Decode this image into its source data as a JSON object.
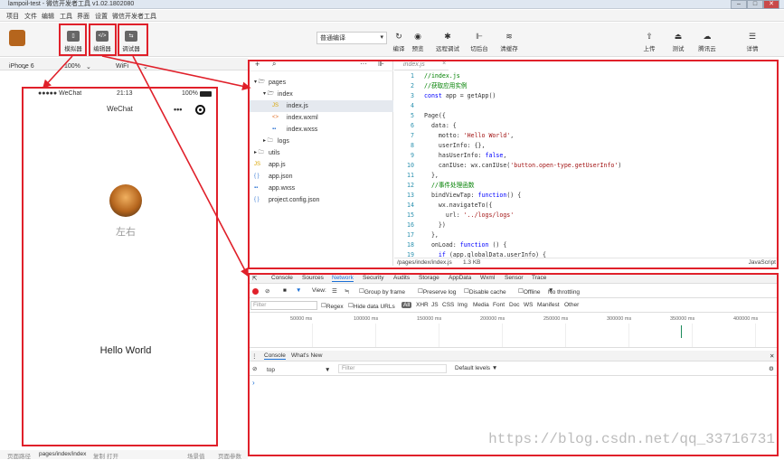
{
  "window": {
    "title": "lampoil-test - 微信开发者工具 v1.02.1802080",
    "min": "–",
    "max": "□",
    "close": "✕"
  },
  "menu": [
    "项目",
    "文件",
    "编辑",
    "工具",
    "界面",
    "设置",
    "微信开发者工具"
  ],
  "toolbar": {
    "left_buttons": [
      {
        "label": "模拟器",
        "icon": "phone-icon"
      },
      {
        "label": "编辑器",
        "icon": "code-icon"
      },
      {
        "label": "调试器",
        "icon": "debug-icon"
      }
    ],
    "compile_mode": "普通编译",
    "mid_buttons": [
      "编译",
      "预览",
      "远程调试",
      "切后台",
      "清缓存"
    ],
    "right_buttons": [
      "上传",
      "测试",
      "腾讯云",
      "详情"
    ]
  },
  "device": {
    "model": "iPhone 6",
    "zoom": "100%",
    "network": "WiFi"
  },
  "phone": {
    "carrier": "●●●●● WeChat",
    "time": "21:13",
    "battery": "100%",
    "nav_title": "WeChat",
    "nickname": "左右",
    "motto": "Hello World"
  },
  "file_tree": [
    {
      "label": "pages",
      "indent": 0,
      "kind": "folder-open"
    },
    {
      "label": "index",
      "indent": 1,
      "kind": "folder-open"
    },
    {
      "label": "index.js",
      "indent": 2,
      "kind": "js",
      "selected": true
    },
    {
      "label": "index.wxml",
      "indent": 2,
      "kind": "wxml"
    },
    {
      "label": "index.wxss",
      "indent": 2,
      "kind": "wxss"
    },
    {
      "label": "logs",
      "indent": 1,
      "kind": "folder"
    },
    {
      "label": "utils",
      "indent": 0,
      "kind": "folder"
    },
    {
      "label": "app.js",
      "indent": 0,
      "kind": "js"
    },
    {
      "label": "app.json",
      "indent": 0,
      "kind": "json"
    },
    {
      "label": "app.wxss",
      "indent": 0,
      "kind": "wxss"
    },
    {
      "label": "project.config.json",
      "indent": 0,
      "kind": "json"
    }
  ],
  "editor": {
    "tab": "index.js",
    "lines": [
      "//index.js",
      "//获取应用实例",
      "const app = getApp()",
      "",
      "Page({",
      "  data: {",
      "    motto: 'Hello World',",
      "    userInfo: {},",
      "    hasUserInfo: false,",
      "    canIUse: wx.canIUse('button.open-type.getUserInfo')",
      "  },",
      "  //事件处理函数",
      "  bindViewTap: function() {",
      "    wx.navigateTo({",
      "      url: '../logs/logs'",
      "    })",
      "  },",
      "  onLoad: function () {",
      "    if (app.globalData.userInfo) {"
    ],
    "path": "/pages/index/index.js",
    "size": "1.3 KB",
    "lang": "JavaScript"
  },
  "devtools": {
    "tabs": [
      "Console",
      "Sources",
      "Network",
      "Security",
      "Audits",
      "Storage",
      "AppData",
      "Wxml",
      "Sensor",
      "Trace"
    ],
    "network_opts": [
      "View:",
      "Group by frame",
      "Preserve log",
      "Disable cache",
      "Offline",
      "No throttling"
    ],
    "filter_placeholder": "Filter",
    "filter_opts": [
      "Regex",
      "Hide data URLs",
      "All",
      "XHR",
      "JS",
      "CSS",
      "Img",
      "Media",
      "Font",
      "Doc",
      "WS",
      "Manifest",
      "Other"
    ],
    "timeline_ticks": [
      "50000 ms",
      "100000 ms",
      "150000 ms",
      "200000 ms",
      "250000 ms",
      "300000 ms",
      "350000 ms",
      "400000 ms"
    ],
    "drawer_tabs": [
      "Console",
      "What's New"
    ],
    "context": "top",
    "console_filter": "Filter",
    "levels": "Default levels ▼",
    "prompt": "›"
  },
  "bottom": {
    "left": "页面路径",
    "path": "pages/index/index",
    "copy": "复制",
    "open": "打开",
    "scene": "场景值",
    "params": "页面参数"
  },
  "watermark": "https://blog.csdn.net/qq_33716731",
  "colors": {
    "annotation": "#e0202a",
    "accent_blue": "#1a6fd6"
  }
}
